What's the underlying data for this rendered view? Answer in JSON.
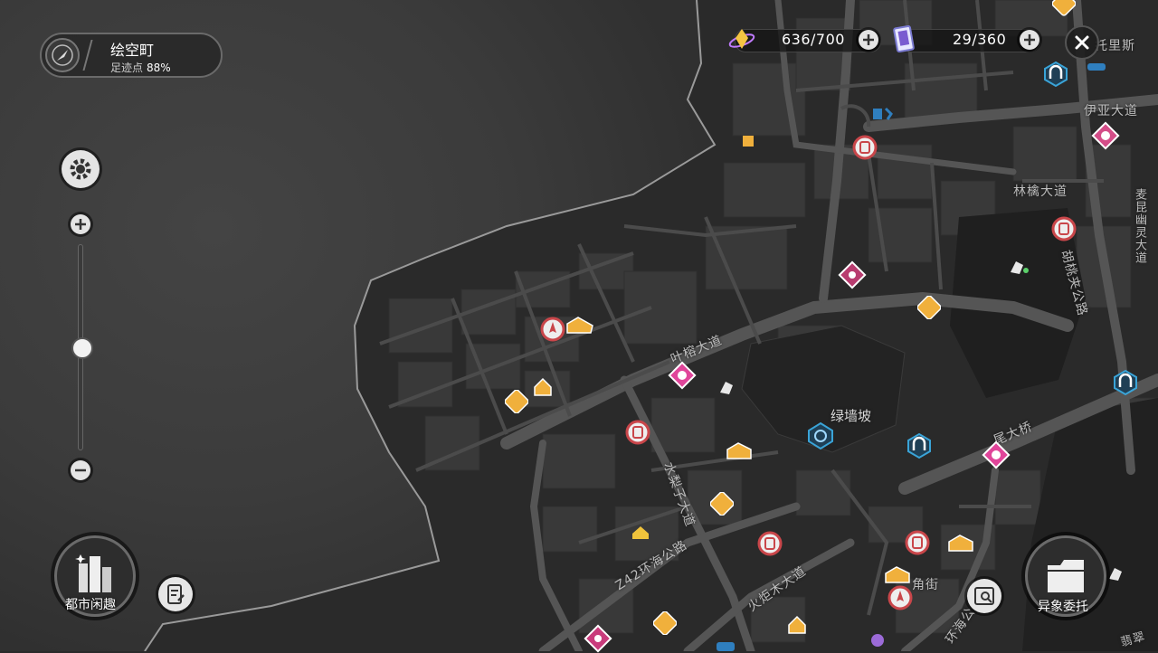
{
  "location": {
    "name": "绘空町",
    "progress_label": "足迹点",
    "progress_value": "88%",
    "compass_icon": "compass-icon"
  },
  "resources": {
    "stamina": {
      "value": "636/700",
      "icon": "stamina-crystal-icon"
    },
    "cards": {
      "value": "29/360",
      "icon": "card-pack-icon"
    }
  },
  "controls": {
    "settings_icon": "gear-icon",
    "zoom_in": "+",
    "zoom_out": "−",
    "close_icon": "close-icon",
    "zoom_level_percent": 55
  },
  "bottom_buttons": {
    "city_fun": "都市闲趣",
    "anomaly_quest": "异象委托"
  },
  "road_labels": {
    "label_1": "托里斯",
    "label_2": "伊亚大道",
    "label_3": "林檎大道",
    "label_4": "麦昆幽灵大道",
    "label_5": "胡桃夹公路",
    "label_6": "叶榕大道",
    "label_7": "水梨子大道",
    "label_8": "Z42环海公路",
    "label_9": "火炬木大道",
    "label_10": "尾大桥",
    "label_11": "角街",
    "label_12": "环海公",
    "label_13": "翡翠"
  },
  "place_labels": {
    "green_wall_slope": "绿墙坡"
  },
  "colors": {
    "water": "#3b3b3b",
    "land": "#2b2b2b",
    "block": "#3a3a3a",
    "road": "#555555",
    "shop_orange": "#f0b03c",
    "pink": "#e0459a",
    "blue": "#3aa4d8",
    "red_outline": "#c9464a"
  }
}
